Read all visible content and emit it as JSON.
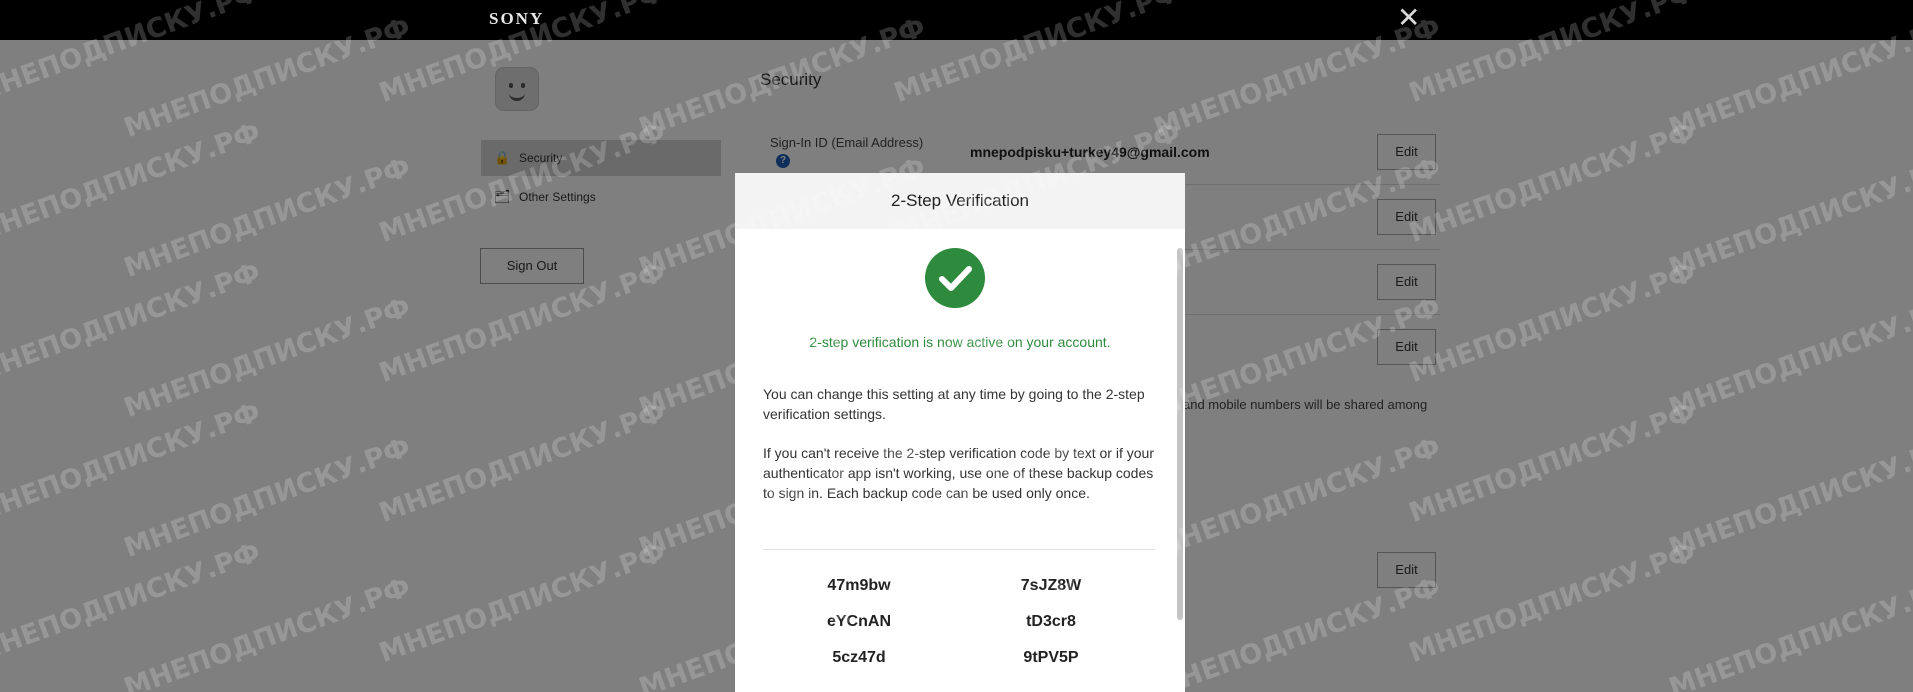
{
  "header": {
    "brand": "SONY",
    "close_glyph": "✕"
  },
  "sidebar": {
    "items": [
      {
        "label": "Security",
        "icon": "lock-icon",
        "glyph": "🔒"
      },
      {
        "label": "Other Settings",
        "icon": "settings-list-icon",
        "glyph": "🗂"
      }
    ],
    "signout_label": "Sign Out"
  },
  "main": {
    "title": "Security",
    "signin": {
      "label": "Sign-In ID (Email Address)",
      "help_glyph": "?",
      "value": "mnepodpisku+turkey49@gmail.com"
    },
    "edit_label": "Edit",
    "note_fragment": "and mobile numbers will be shared among"
  },
  "watermark_text": "МНЕПОДПИСКУ.РФ",
  "modal": {
    "title": "2-Step Verification",
    "success_text": "2-step verification is now active on your account.",
    "para1": "You can change this setting at any time by going to the 2-step verification settings.",
    "para2": "If you can't receive the 2-step verification code by text or if your authenticator app isn't working, use one of these backup codes to sign in. Each backup code can be used only once.",
    "codes": [
      "47m9bw",
      "7sJZ8W",
      "eYCnAN",
      "tD3cr8",
      "5cz47d",
      "9tPV5P"
    ],
    "success_color": "#2e8b3d"
  }
}
